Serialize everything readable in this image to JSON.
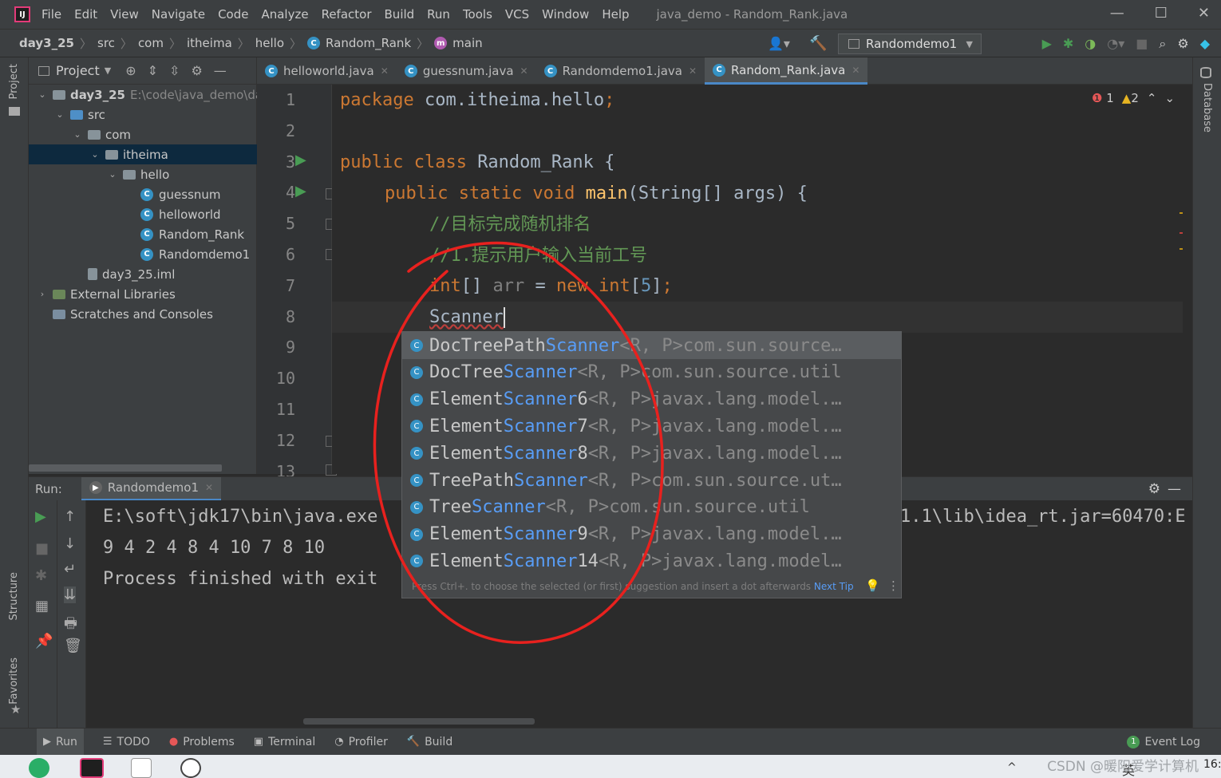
{
  "app": {
    "logo": "IJ",
    "menus": [
      "File",
      "Edit",
      "View",
      "Navigate",
      "Code",
      "Analyze",
      "Refactor",
      "Build",
      "Run",
      "Tools",
      "VCS",
      "Window",
      "Help"
    ],
    "window_title": "java_demo - Random_Rank.java",
    "window_controls": [
      "—",
      "☐",
      "✕"
    ]
  },
  "breadcrumbs": [
    "day3_25",
    "src",
    "com",
    "itheima",
    "hello",
    "Random_Rank",
    "main"
  ],
  "run_config": "Randomdemo1",
  "left_strip": {
    "project": "Project",
    "structure": "Structure",
    "favorites": "Favorites"
  },
  "right_strip": {
    "database": "Database"
  },
  "project_panel": {
    "title": "Project",
    "tree": [
      {
        "label": "day3_25",
        "extra": "E:\\code\\java_demo\\da",
        "kind": "module",
        "expanded": true,
        "indent": 0
      },
      {
        "label": "src",
        "kind": "folder-blue",
        "expanded": true,
        "indent": 1
      },
      {
        "label": "com",
        "kind": "folder",
        "expanded": true,
        "indent": 2
      },
      {
        "label": "itheima",
        "kind": "folder",
        "expanded": true,
        "indent": 3,
        "selected": true
      },
      {
        "label": "hello",
        "kind": "folder",
        "expanded": true,
        "indent": 4
      },
      {
        "label": "guessnum",
        "kind": "class",
        "indent": 5
      },
      {
        "label": "helloworld",
        "kind": "class",
        "indent": 5
      },
      {
        "label": "Random_Rank",
        "kind": "class",
        "indent": 5
      },
      {
        "label": "Randomdemo1",
        "kind": "class",
        "indent": 5
      },
      {
        "label": "day3_25.iml",
        "kind": "file",
        "indent": 2
      },
      {
        "label": "External Libraries",
        "kind": "libs",
        "indent": 0
      },
      {
        "label": "Scratches and Consoles",
        "kind": "scratch",
        "indent": 0
      }
    ]
  },
  "editor_tabs": [
    {
      "label": "helloworld.java",
      "active": false
    },
    {
      "label": "guessnum.java",
      "active": false
    },
    {
      "label": "Randomdemo1.java",
      "active": false
    },
    {
      "label": "Random_Rank.java",
      "active": true
    }
  ],
  "inspections": {
    "errors": "1",
    "warnings": "2"
  },
  "line_numbers": [
    "1",
    "2",
    "3",
    "4",
    "5",
    "6",
    "7",
    "8",
    "9",
    "10",
    "11",
    "12",
    "13"
  ],
  "code": {
    "l1_kw": "package ",
    "l1_rest": "com.itheima.hello",
    "l1_semi": ";",
    "l3_kw": "public class ",
    "l3_name": "Random_Rank ",
    "l3_brace": "{",
    "l4_kw": "public static void ",
    "l4_fn": "main",
    "l4_rest": "(String[] args) {",
    "l5_comment": "//目标完成随机排名",
    "l6_comment": "//1.提示用户输入当前工号",
    "l7_kw": "int",
    "l7_a": "[] ",
    "l7_var": "arr",
    "l7_b": " = ",
    "l7_new": "new ",
    "l7_int": "int",
    "l7_c": "[",
    "l7_num": "5",
    "l7_d": "]",
    "l7_semi": ";",
    "l8_text": "Scanner"
  },
  "completion": {
    "items": [
      {
        "pre": "DocTreePath",
        "match": "Scanner",
        "post": "",
        "gen": "<R, P>",
        "pkg": " com.sun.source…"
      },
      {
        "pre": "DocTree",
        "match": "Scanner",
        "post": "",
        "gen": "<R, P>",
        "pkg": " com.sun.source.util"
      },
      {
        "pre": "Element",
        "match": "Scanner",
        "post": "6",
        "gen": "<R, P>",
        "pkg": " javax.lang.model.…"
      },
      {
        "pre": "Element",
        "match": "Scanner",
        "post": "7",
        "gen": "<R, P>",
        "pkg": " javax.lang.model.…"
      },
      {
        "pre": "Element",
        "match": "Scanner",
        "post": "8",
        "gen": "<R, P>",
        "pkg": " javax.lang.model.…"
      },
      {
        "pre": "TreePath",
        "match": "Scanner",
        "post": "",
        "gen": "<R, P>",
        "pkg": " com.sun.source.ut…"
      },
      {
        "pre": "Tree",
        "match": "Scanner",
        "post": "",
        "gen": "<R, P>",
        "pkg": " com.sun.source.util"
      },
      {
        "pre": "Element",
        "match": "Scanner",
        "post": "9",
        "gen": "<R, P>",
        "pkg": " javax.lang.model.…"
      },
      {
        "pre": "Element",
        "match": "Scanner",
        "post": "14",
        "gen": "<R, P>",
        "pkg": " javax.lang.model…"
      }
    ],
    "hint": "Press Ctrl+. to choose the selected (or first) suggestion and insert a dot afterwards",
    "next_tip": "Next Tip"
  },
  "run_panel": {
    "label": "Run:",
    "tab": "Randomdemo1",
    "console": [
      "E:\\soft\\jdk17\\bin\\java.exe",
      "9 4 2 4 8 4 10 7 8 10",
      "Process finished with exit"
    ],
    "console_tail": "1.1\\lib\\idea_rt.jar=60470:E"
  },
  "bottom_tools": [
    "Run",
    "TODO",
    "Problems",
    "Terminal",
    "Profiler",
    "Build"
  ],
  "event_log": {
    "count": "1",
    "label": "Event Log"
  },
  "taskbar": {
    "watermark": "CSDN @暖阳爱学计算机",
    "ime": "英",
    "clock_fragment": "16:"
  },
  "colors": {
    "keyword": "#cc7832",
    "function": "#ffc66d",
    "comment": "#629755",
    "number": "#6897bb",
    "match_highlight": "#589df6",
    "annotation": "#e8211e",
    "run_green": "#499c54"
  }
}
